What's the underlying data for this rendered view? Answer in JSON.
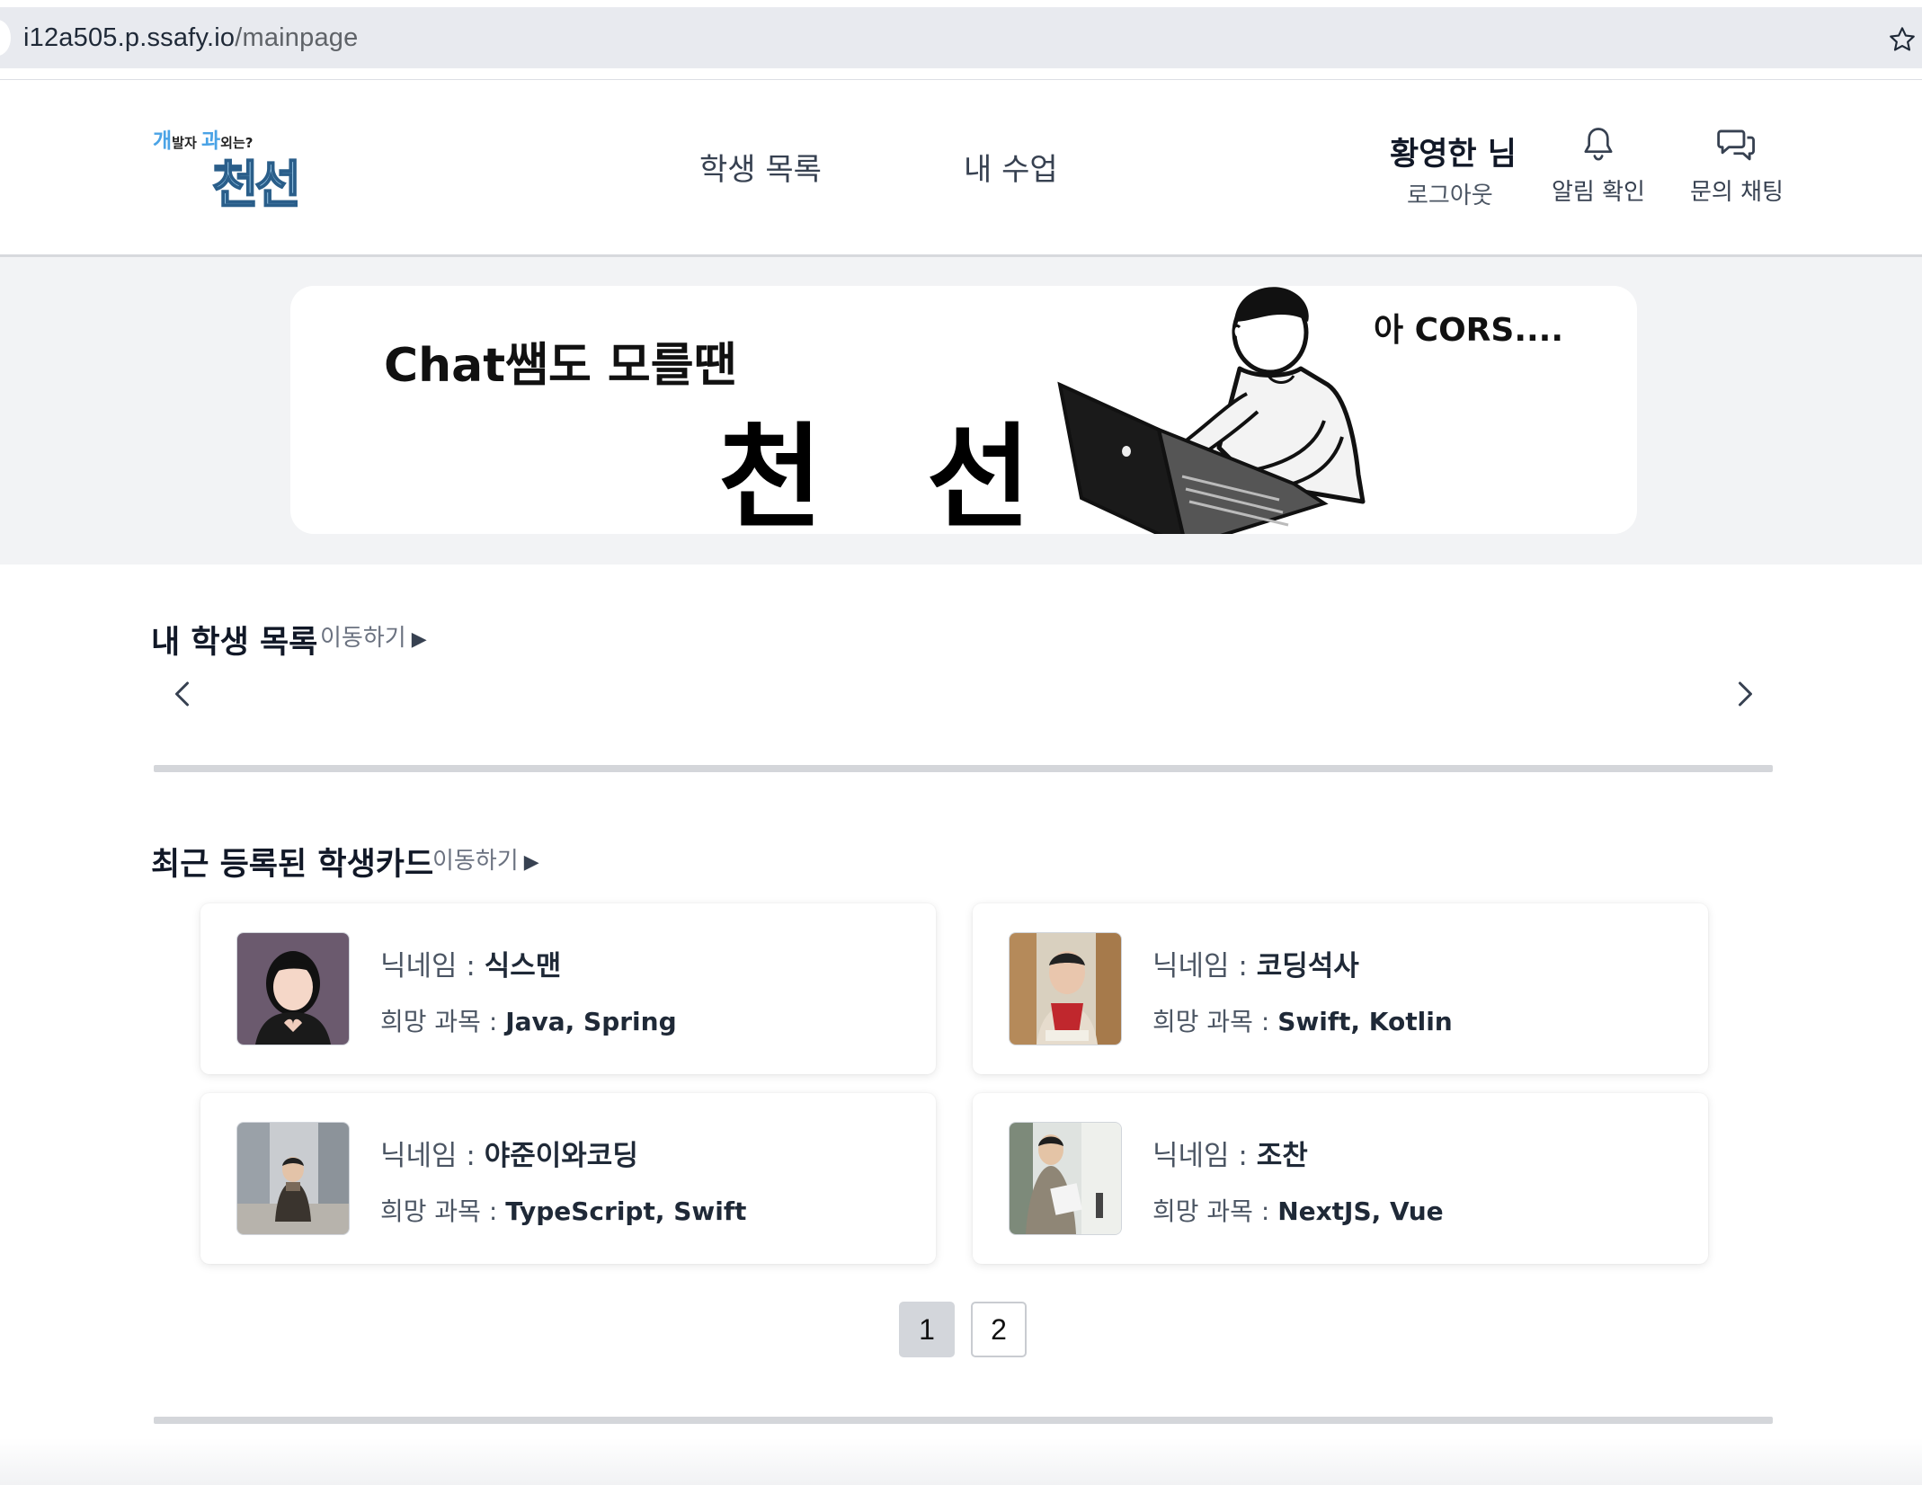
{
  "browser": {
    "url_host": "i12a505.p.ssafy.io",
    "url_path": "/mainpage"
  },
  "header": {
    "logo": {
      "line_small_1": "개",
      "line_small_2": "발자 ",
      "line_small_3": "과",
      "line_small_4": "외는?",
      "line_big": "천선"
    },
    "nav": [
      "학생 목록",
      "내 수업"
    ],
    "user_name": "황영한 님",
    "logout_label": "로그아웃",
    "notification_label": "알림 확인",
    "chat_label": "문의 채팅"
  },
  "banner": {
    "subtitle": "Chat쌤도 모를땐",
    "title": "천 선",
    "speech": "아 CORS...."
  },
  "my_students": {
    "title": "내 학생 목록",
    "link": "이동하기",
    "link_arrow": "▶"
  },
  "recent_cards": {
    "title": "최근 등록된 학생카드",
    "link": "이동하기",
    "link_arrow": "▶",
    "nickname_label": "닉네임 : ",
    "subject_label": "희망 과목 : ",
    "cards": [
      {
        "nickname": "식스맨",
        "subjects": "Java, Spring"
      },
      {
        "nickname": "코딩석사",
        "subjects": "Swift, Kotlin"
      },
      {
        "nickname": "야준이와코딩",
        "subjects": "TypeScript, Swift"
      },
      {
        "nickname": "조찬",
        "subjects": "NextJS, Vue"
      }
    ]
  },
  "pagination": {
    "pages": [
      "1",
      "2"
    ],
    "active": "1"
  },
  "icons": [
    "star-icon",
    "bell-icon",
    "chat-icon",
    "chevron-left-icon",
    "chevron-right-icon"
  ],
  "colors": {
    "logo_blue": "#4aa3e6",
    "banner_bg": "#f2f3f5",
    "active_page": "#d3d6db"
  }
}
